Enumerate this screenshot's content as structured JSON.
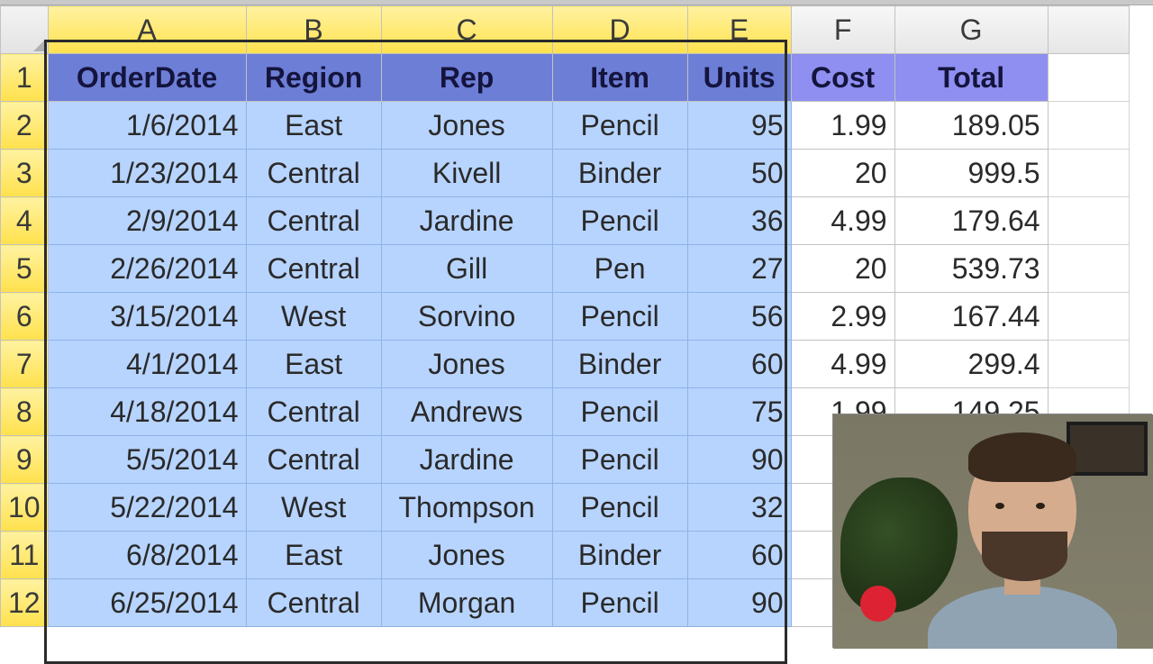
{
  "columns": [
    "A",
    "B",
    "C",
    "D",
    "E",
    "F",
    "G"
  ],
  "row_numbers": [
    1,
    2,
    3,
    4,
    5,
    6,
    7,
    8,
    9,
    10,
    11,
    12
  ],
  "selected_columns": [
    "A",
    "B",
    "C",
    "D",
    "E"
  ],
  "headers": {
    "A": "OrderDate",
    "B": "Region",
    "C": "Rep",
    "D": "Item",
    "E": "Units",
    "F": "Cost",
    "G": "Total"
  },
  "rows": [
    {
      "A": "1/6/2014",
      "B": "East",
      "C": "Jones",
      "D": "Pencil",
      "E": "95",
      "F": "1.99",
      "G": "189.05"
    },
    {
      "A": "1/23/2014",
      "B": "Central",
      "C": "Kivell",
      "D": "Binder",
      "E": "50",
      "F": "20",
      "G": "999.5"
    },
    {
      "A": "2/9/2014",
      "B": "Central",
      "C": "Jardine",
      "D": "Pencil",
      "E": "36",
      "F": "4.99",
      "G": "179.64"
    },
    {
      "A": "2/26/2014",
      "B": "Central",
      "C": "Gill",
      "D": "Pen",
      "E": "27",
      "F": "20",
      "G": "539.73"
    },
    {
      "A": "3/15/2014",
      "B": "West",
      "C": "Sorvino",
      "D": "Pencil",
      "E": "56",
      "F": "2.99",
      "G": "167.44"
    },
    {
      "A": "4/1/2014",
      "B": "East",
      "C": "Jones",
      "D": "Binder",
      "E": "60",
      "F": "4.99",
      "G": "299.4"
    },
    {
      "A": "4/18/2014",
      "B": "Central",
      "C": "Andrews",
      "D": "Pencil",
      "E": "75",
      "F": "1.99",
      "G": "149.25"
    },
    {
      "A": "5/5/2014",
      "B": "Central",
      "C": "Jardine",
      "D": "Pencil",
      "E": "90",
      "F": "",
      "G": ""
    },
    {
      "A": "5/22/2014",
      "B": "West",
      "C": "Thompson",
      "D": "Pencil",
      "E": "32",
      "F": "",
      "G": ""
    },
    {
      "A": "6/8/2014",
      "B": "East",
      "C": "Jones",
      "D": "Binder",
      "E": "60",
      "F": "",
      "G": ""
    },
    {
      "A": "6/25/2014",
      "B": "Central",
      "C": "Morgan",
      "D": "Pencil",
      "E": "90",
      "F": "",
      "G": ""
    }
  ],
  "align": {
    "A": "r",
    "B": "c",
    "C": "c",
    "D": "c",
    "E": "r",
    "F": "r",
    "G": "r"
  }
}
